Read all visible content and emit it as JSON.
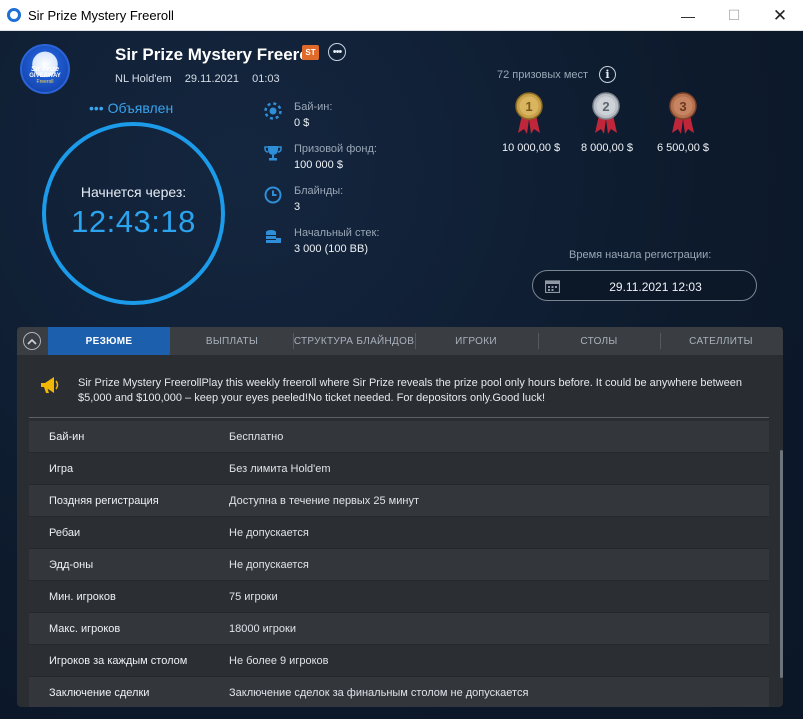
{
  "window": {
    "title": "Sir Prize Mystery Freeroll",
    "min": "—",
    "max": "☐",
    "close": "✕"
  },
  "logo": {
    "line1": "Sir Prize",
    "line2": "GIVEAWAY",
    "line3": "Freeroll"
  },
  "header": {
    "title": "Sir Prize Mystery Freeroll",
    "badge": "ST",
    "more": "•••",
    "game": "NL Hold'em",
    "date": "29.11.2021",
    "time": "01:03"
  },
  "status": "••• Объявлен",
  "countdown": {
    "label": "Начнется через:",
    "value": "12:43:18"
  },
  "info": [
    {
      "icon": "poker-chip-icon",
      "label": "Бай-ин:",
      "value": "0 $"
    },
    {
      "icon": "trophy-icon",
      "label": "Призовой фонд:",
      "value": "100 000 $"
    },
    {
      "icon": "clock-icon",
      "label": "Блайнды:",
      "value": "3"
    },
    {
      "icon": "chip-stack-icon",
      "label": "Начальный стек:",
      "value": "3 000 (100 BB)"
    }
  ],
  "prizes": {
    "places_label": "72 призовых мест",
    "info_icon": "i",
    "items": [
      {
        "rank": "1",
        "amount": "10 000,00 $",
        "color": "#c8a04a"
      },
      {
        "rank": "2",
        "amount": "8 000,00 $",
        "color": "#b9bec6"
      },
      {
        "rank": "3",
        "amount": "6 500,00 $",
        "color": "#b5704e"
      }
    ]
  },
  "registration": {
    "label": "Время начала регистрации:",
    "value": "29.11.2021 12:03"
  },
  "tabs": [
    {
      "label": "РЕЗЮМЕ",
      "active": true
    },
    {
      "label": "ВЫПЛАТЫ",
      "active": false
    },
    {
      "label": "СТРУКТУРА БЛАЙНДОВ",
      "active": false
    },
    {
      "label": "ИГРОКИ",
      "active": false
    },
    {
      "label": "СТОЛЫ",
      "active": false
    },
    {
      "label": "САТЕЛЛИТЫ",
      "active": false
    }
  ],
  "announcement": "Sir Prize Mystery FreerollPlay this weekly freeroll where Sir Prize reveals the prize pool only hours before. It could be anywhere between $5,000 and $100,000 – keep your eyes peeled!No ticket needed. For depositors only.Good luck!",
  "details": [
    {
      "key": "Бай-ин",
      "value": "Бесплатно"
    },
    {
      "key": "Игра",
      "value": "Без лимита Hold'em"
    },
    {
      "key": "Поздняя регистрация",
      "value": "Доступна в течение первых 25 минут"
    },
    {
      "key": "Ребаи",
      "value": "Не допускается"
    },
    {
      "key": "Эдд-оны",
      "value": "Не допускается"
    },
    {
      "key": "Мин. игроков",
      "value": "75 игроки"
    },
    {
      "key": "Макс. игроков",
      "value": "18000 игроки"
    },
    {
      "key": "Игроков за каждым столом",
      "value": "Не более 9 игроков"
    },
    {
      "key": "Заключение сделки",
      "value": "Заключение сделок за финальным столом не допускается"
    }
  ],
  "colors": {
    "accent": "#1b9be9",
    "tab_active": "#1b5fad",
    "background": "#0d1a2c",
    "badge": "#e06a2a"
  }
}
